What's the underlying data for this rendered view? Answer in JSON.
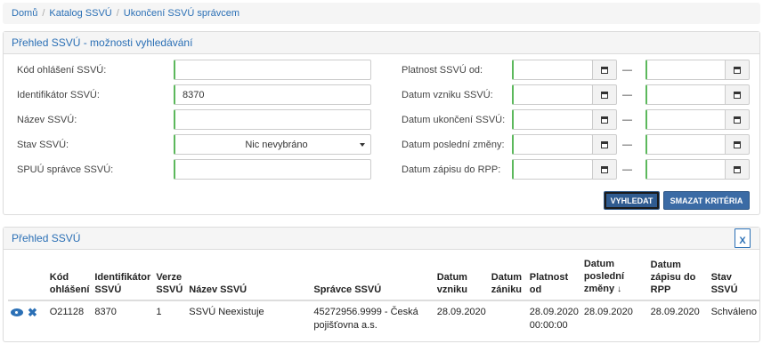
{
  "breadcrumb": [
    "Domů",
    "Katalog SSVÚ",
    "Ukončení SSVÚ správcem"
  ],
  "search": {
    "title": "Přehled SSVÚ - možnosti vyhledávání",
    "left_fields": [
      {
        "label": "Kód ohlášení SSVÚ:",
        "value": ""
      },
      {
        "label": "Identifikátor SSVÚ:",
        "value": "8370"
      },
      {
        "label": "Název SSVÚ:",
        "value": ""
      },
      {
        "label": "Stav SSVÚ:",
        "value": "Nic nevybráno"
      },
      {
        "label": "SPUÚ správce SSVÚ:",
        "value": ""
      }
    ],
    "right_fields": [
      {
        "label": "Platnost SSVÚ od:"
      },
      {
        "label": "Datum vzniku SSVÚ:"
      },
      {
        "label": "Datum ukončení SSVÚ:"
      },
      {
        "label": "Datum poslední změny:"
      },
      {
        "label": "Datum zápisu do RPP:"
      }
    ],
    "range_separator": "—",
    "search_button": "VYHLEDAT",
    "clear_button": "SMAZAT KRITÉRIA"
  },
  "results": {
    "title": "Přehled SSVÚ",
    "export_icon_label": "X",
    "columns": [
      "Kód ohlášení",
      "Identifikátor SSVÚ",
      "Verze SSVÚ",
      "Název SSVÚ",
      "Správce SSVÚ",
      "Datum vzniku",
      "Datum zániku",
      "Platnost od",
      "Datum poslední změny",
      "Datum zápisu do RPP",
      "Stav SSVÚ"
    ],
    "rows": [
      {
        "kod": "O21128",
        "id": "8370",
        "verze": "1",
        "nazev": "SSVÚ Neexistuje",
        "spravce": "45272956.9999 - Česká pojišťovna a.s.",
        "vznik": "28.09.2020",
        "zanik": "",
        "platnost": "28.09.2020 00:00:00",
        "zmena": "28.09.2020",
        "zapis": "28.09.2020",
        "stav": "Schváleno"
      }
    ]
  }
}
